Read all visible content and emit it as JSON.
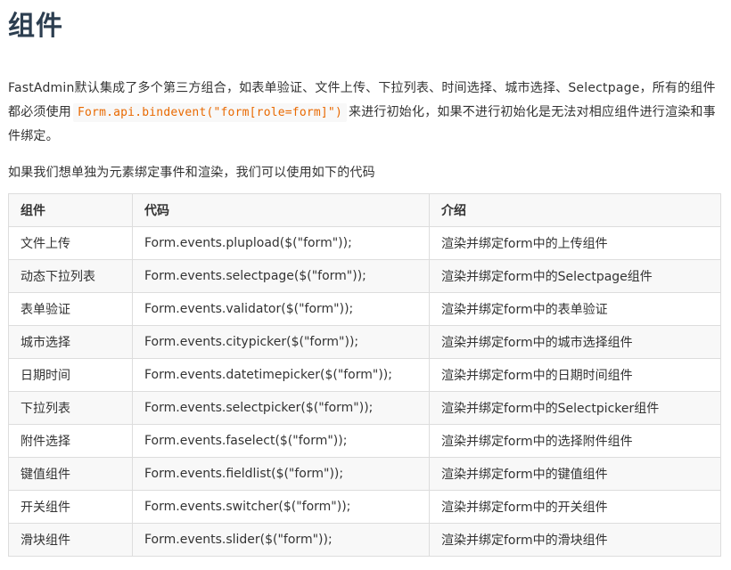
{
  "heading": "组件",
  "intro": {
    "before": "FastAdmin默认集成了多个第三方组合，如表单验证、文件上传、下拉列表、时间选择、城市选择、Selectpage，所有的组件都必须使用",
    "code": "Form.api.bindevent(\"form[role=form]\")",
    "after": "来进行初始化，如果不进行初始化是无法对相应组件进行渲染和事件绑定。"
  },
  "lead": "如果我们想单独为元素绑定事件和渲染，我们可以使用如下的代码",
  "table": {
    "headers": [
      "组件",
      "代码",
      "介绍"
    ],
    "rows": [
      [
        "文件上传",
        "Form.events.plupload($(\"form\"));",
        "渲染并绑定form中的上传组件"
      ],
      [
        "动态下拉列表",
        "Form.events.selectpage($(\"form\"));",
        "渲染并绑定form中的Selectpage组件"
      ],
      [
        "表单验证",
        "Form.events.validator($(\"form\"));",
        "渲染并绑定form中的表单验证"
      ],
      [
        "城市选择",
        "Form.events.citypicker($(\"form\"));",
        "渲染并绑定form中的城市选择组件"
      ],
      [
        "日期时间",
        "Form.events.datetimepicker($(\"form\"));",
        "渲染并绑定form中的日期时间组件"
      ],
      [
        "下拉列表",
        "Form.events.selectpicker($(\"form\"));",
        "渲染并绑定form中的Selectpicker组件"
      ],
      [
        "附件选择",
        "Form.events.faselect($(\"form\"));",
        "渲染并绑定form中的选择附件组件"
      ],
      [
        "键值组件",
        "Form.events.fieldlist($(\"form\"));",
        "渲染并绑定form中的键值组件"
      ],
      [
        "开关组件",
        "Form.events.switcher($(\"form\"));",
        "渲染并绑定form中的开关组件"
      ],
      [
        "滑块组件",
        "Form.events.slider($(\"form\"));",
        "渲染并绑定form中的滑块组件"
      ]
    ]
  }
}
